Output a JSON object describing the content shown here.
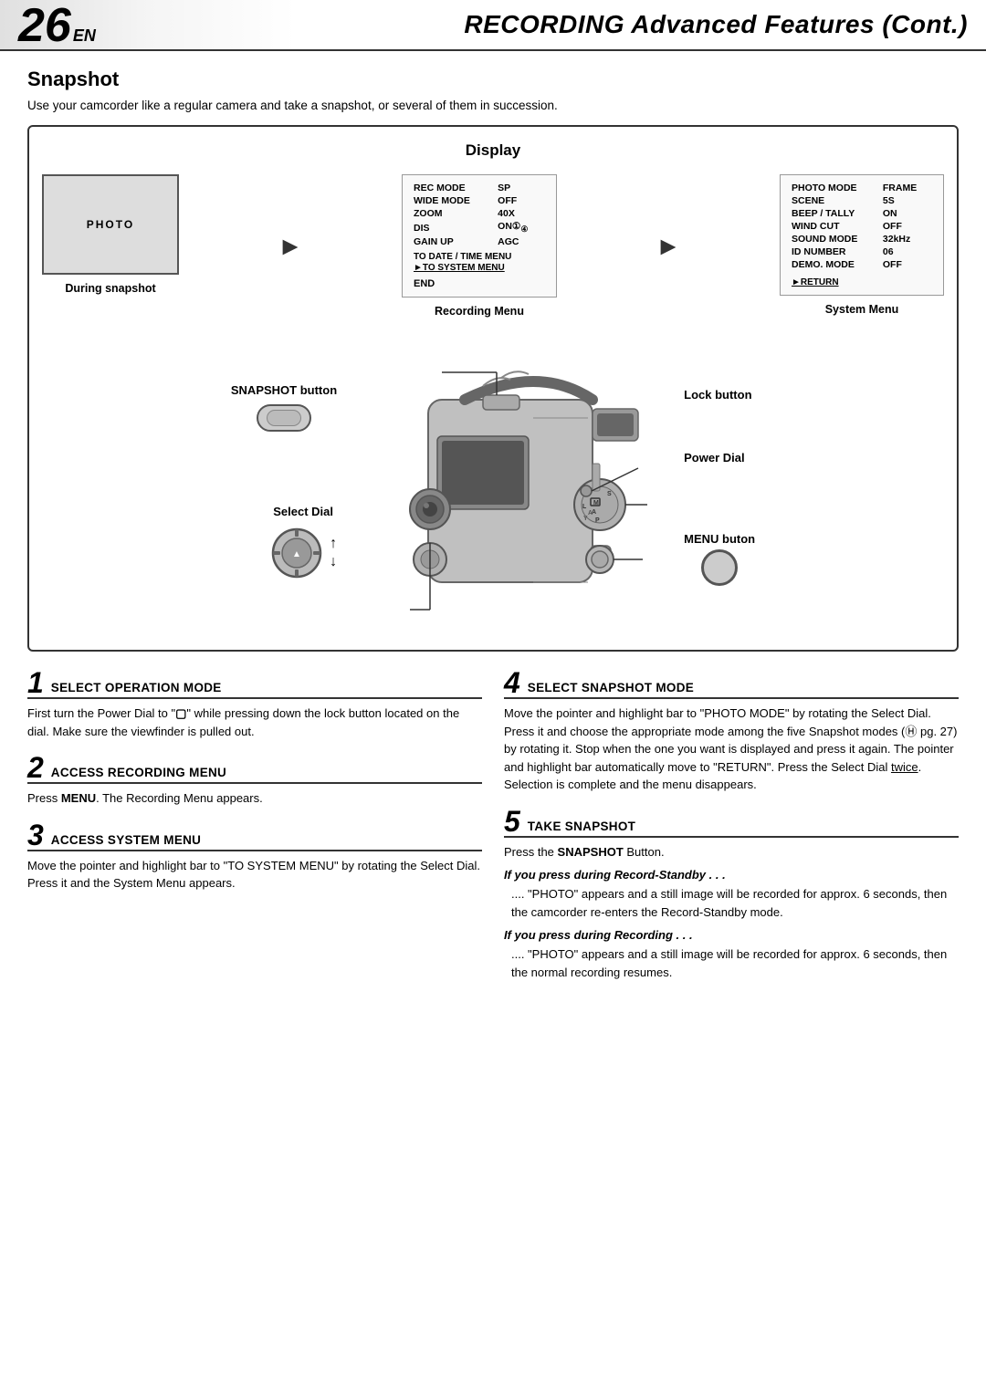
{
  "header": {
    "page_number": "26",
    "en_suffix": "EN",
    "title": "RECORDING Advanced Features (Cont.)"
  },
  "section": {
    "title": "Snapshot",
    "intro": "Use your camcorder like a regular camera and take a snapshot, or several of them in succession."
  },
  "display_box": {
    "label": "Display",
    "panel_during_snapshot": {
      "content": "PHOTO",
      "caption": "During snapshot"
    },
    "panel_recording_menu": {
      "caption": "Recording Menu",
      "rows": [
        [
          "REC MODE",
          "SP"
        ],
        [
          "WIDE MODE",
          "OFF"
        ],
        [
          "ZOOM",
          "40X"
        ],
        [
          "DIS",
          "ON"
        ],
        [
          "GAIN UP",
          "AGC"
        ]
      ],
      "link1": "TO DATE / TIME MENU",
      "link2": "TO SYSTEM MENU",
      "end": "END"
    },
    "panel_system_menu": {
      "caption": "System Menu",
      "rows": [
        [
          "PHOTO MODE",
          "FRAME"
        ],
        [
          "SCENE",
          "5S"
        ],
        [
          "BEEP / TALLY",
          "ON"
        ],
        [
          "WIND CUT",
          "OFF"
        ],
        [
          "SOUND MODE",
          "32kHz"
        ],
        [
          "ID NUMBER",
          "06"
        ],
        [
          "DEMO. MODE",
          "OFF"
        ]
      ],
      "return": "RETURN"
    }
  },
  "diagram": {
    "snapshot_button_label": "SNAPSHOT button",
    "select_dial_label": "Select Dial",
    "lock_button_label": "Lock button",
    "power_dial_label": "Power Dial",
    "menu_button_label": "MENU buton"
  },
  "steps": [
    {
      "number": "1",
      "title": "SELECT OPERATION MODE",
      "body": "First turn the Power Dial to \"□\" while pressing down the lock button located on the dial. Make sure the viewfinder is pulled out."
    },
    {
      "number": "4",
      "title": "SELECT SNAPSHOT MODE",
      "body": "Move the pointer and highlight bar to \"PHOTO MODE\" by rotating the Select Dial. Press it and choose the appropriate mode among the five Snapshot modes (☂ pg. 27) by rotating it. Stop when the one you want is displayed and press it again. The pointer and highlight bar automatically move to \"RETURN\". Press the Select Dial twice. Selection is complete and the menu disappears."
    },
    {
      "number": "2",
      "title": "ACCESS RECORDING MENU",
      "body": "Press MENU. The Recording Menu appears."
    },
    {
      "number": "5",
      "title": "TAKE SNAPSHOT",
      "body": "Press the SNAPSHOT Button.",
      "notes": [
        {
          "heading": "If you press during Record-Standby . . .",
          "text": ".... \"PHOTO\" appears and a still image will be recorded for approx. 6 seconds, then the camcorder re-enters the Record-Standby mode."
        },
        {
          "heading": "If you press during Recording . . .",
          "text": ".... \"PHOTO\" appears and a still image will be recorded for approx. 6 seconds, then the normal recording resumes."
        }
      ]
    },
    {
      "number": "3",
      "title": "ACCESS SYSTEM MENU",
      "body": "Move the pointer and highlight bar to \"TO SYSTEM MENU\" by rotating the Select Dial. Press it and the System Menu appears."
    }
  ]
}
